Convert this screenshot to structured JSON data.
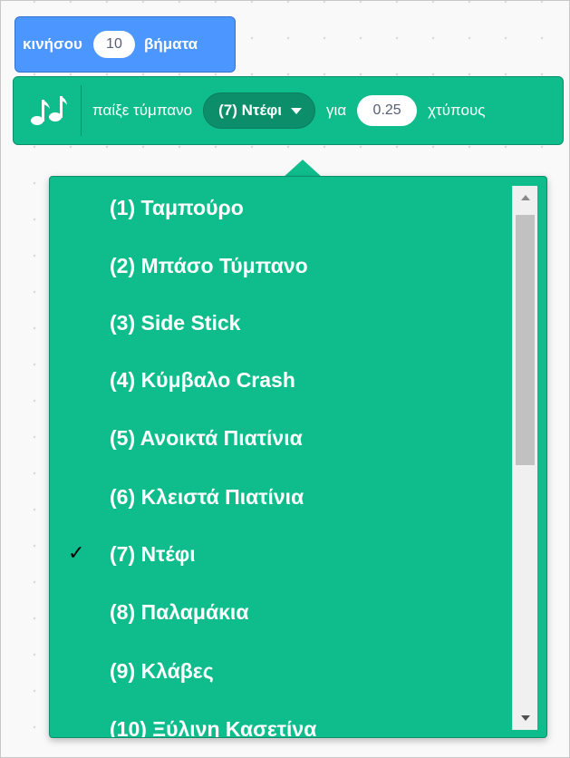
{
  "motion_block": {
    "label_move": "κινήσου",
    "steps_value": "10",
    "label_steps": "βήματα",
    "color": "#4c97ff"
  },
  "music_block": {
    "icon": "music-notes-icon",
    "label_play": "παίξε τύμπανο",
    "selected_drum": "(7) Ντέφι",
    "label_for": "για",
    "beats_value": "0.25",
    "label_beats": "χτύπους",
    "color": "#0fbd8c"
  },
  "drum_menu": {
    "checkmark": "✓",
    "selected_index": 6,
    "items": [
      "(1) Ταμπούρο",
      "(2) Μπάσο Τύμπανο",
      "(3) Side Stick",
      "(4) Κύμβαλο Crash",
      "(5) Ανοικτά Πιατίνια",
      "(6) Κλειστά Πιατίνια",
      "(7) Ντέφι",
      "(8) Παλαμάκια",
      "(9) Κλάβες",
      "(10) Ξύλινη Κασετίνα"
    ]
  }
}
